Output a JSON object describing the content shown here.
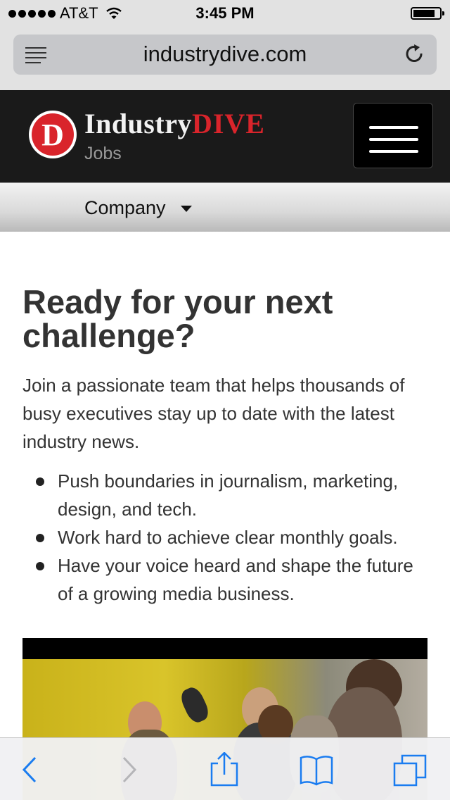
{
  "status_bar": {
    "carrier": "AT&T",
    "time": "3:45 PM"
  },
  "browser": {
    "url": "industrydive.com"
  },
  "header": {
    "brand_word": "Industry",
    "brand_accent": "DIVE",
    "subtitle": "Jobs",
    "logo_letter": "D"
  },
  "subnav": {
    "label": "Company"
  },
  "main": {
    "heading": "Ready for your next challenge?",
    "intro": "Join a passionate team that helps thousands of busy executives stay up to date with the latest industry news.",
    "bullets": [
      "Push boundaries in journalism, marketing, design, and tech.",
      "Work hard to achieve clear monthly goals.",
      "Have your voice heard and shape the future of a growing media business."
    ]
  },
  "colors": {
    "accent_red": "#d9242b",
    "header_bg": "#1a1a1a",
    "ios_blue": "#1a7cf0"
  },
  "icons": [
    "reader-icon",
    "reload-icon",
    "hamburger-icon",
    "back-icon",
    "forward-icon",
    "share-icon",
    "bookmarks-icon",
    "tabs-icon"
  ]
}
